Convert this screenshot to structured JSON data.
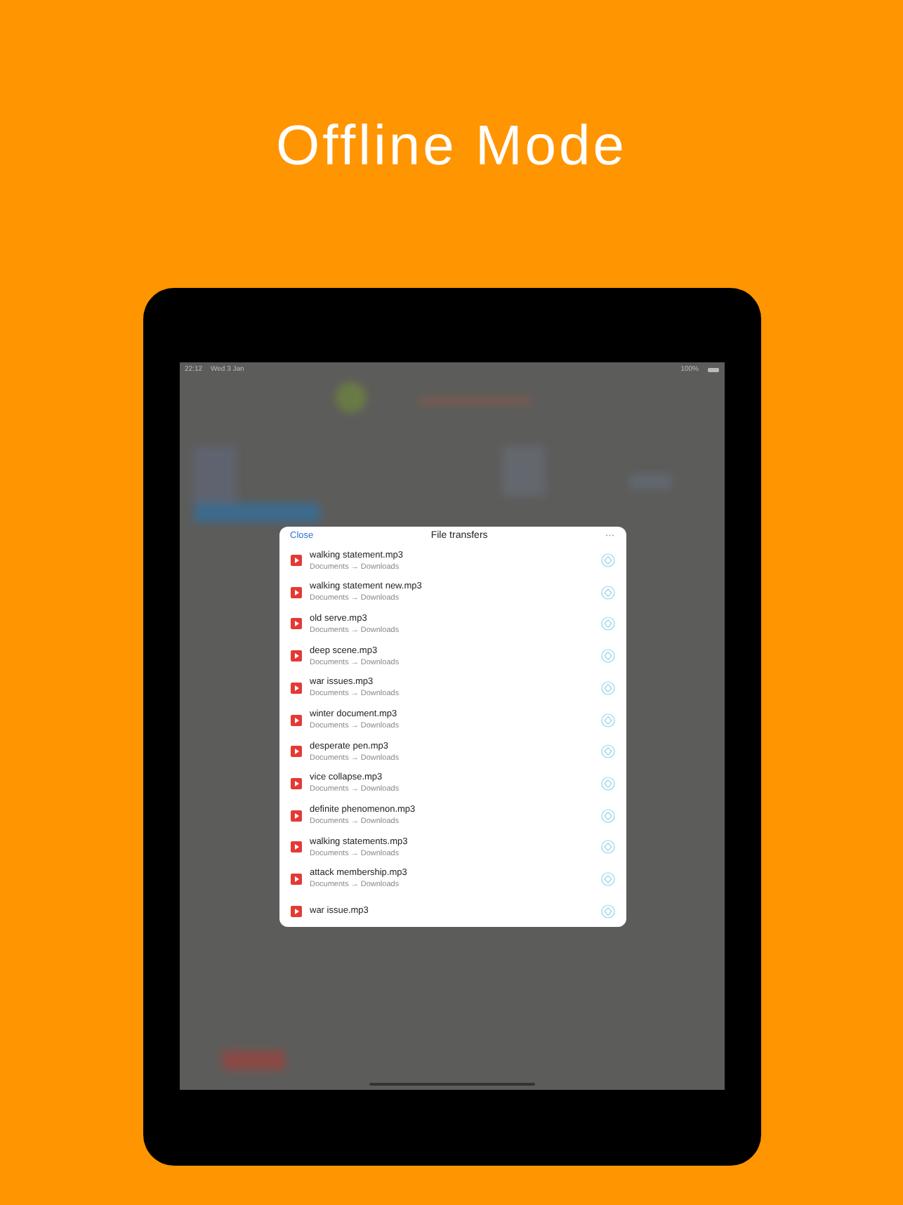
{
  "headline": "Offline Mode",
  "status_bar": {
    "time": "22:12",
    "date": "Wed 3 Jan",
    "battery": "100%"
  },
  "dialog": {
    "close": "Close",
    "title": "File transfers",
    "more": "···",
    "files": [
      {
        "name": "walking statement.mp3",
        "path": "Documents → Downloads"
      },
      {
        "name": "walking statement new.mp3",
        "path": "Documents → Downloads"
      },
      {
        "name": "old serve.mp3",
        "path": "Documents → Downloads"
      },
      {
        "name": "deep scene.mp3",
        "path": "Documents → Downloads"
      },
      {
        "name": "war issues.mp3",
        "path": "Documents → Downloads"
      },
      {
        "name": "winter document.mp3",
        "path": "Documents → Downloads"
      },
      {
        "name": "desperate pen.mp3",
        "path": "Documents → Downloads"
      },
      {
        "name": "vice collapse.mp3",
        "path": "Documents → Downloads"
      },
      {
        "name": "definite phenomenon.mp3",
        "path": "Documents → Downloads"
      },
      {
        "name": "walking statements.mp3",
        "path": "Documents → Downloads"
      },
      {
        "name": "attack membership.mp3",
        "path": "Documents → Downloads"
      },
      {
        "name": "war issue.mp3"
      }
    ]
  }
}
